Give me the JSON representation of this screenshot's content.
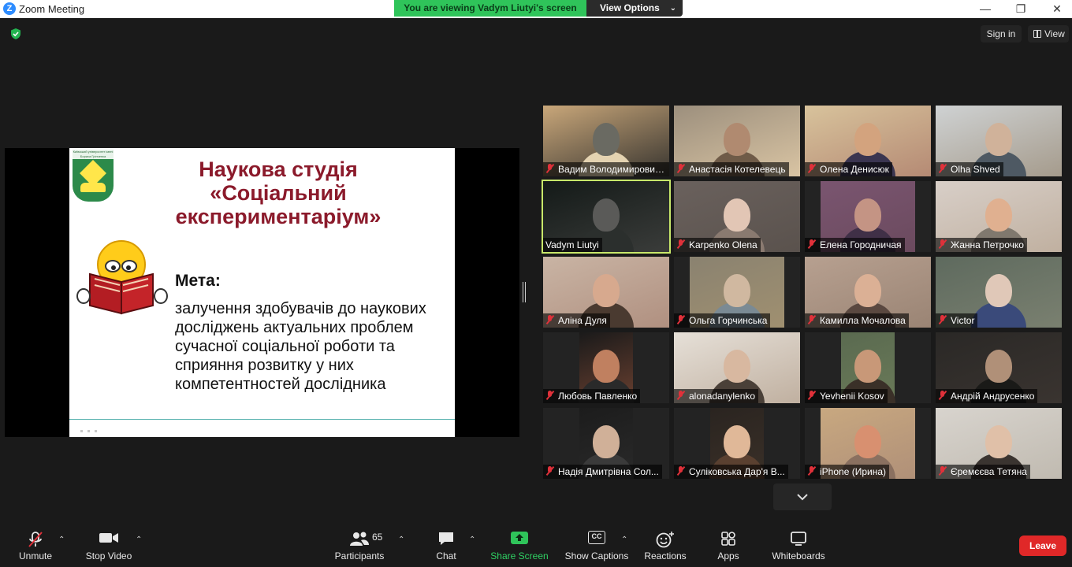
{
  "window": {
    "title": "Zoom Meeting",
    "app_icon_letter": "Z",
    "controls": {
      "minimize": "—",
      "restore": "❐",
      "close": "✕"
    }
  },
  "banner": {
    "viewing_text": "You are viewing Vadym Liutyi's screen",
    "view_options_label": "View Options"
  },
  "top_right": {
    "sign_in_label": "Sign in",
    "view_label": "View"
  },
  "slide": {
    "logo_caption": "Київський університет імені Бориса Грінченка",
    "title_lines": [
      "Наукова студія",
      "«Соціальний",
      "експериментаріум»"
    ],
    "goal_label": "Мета:",
    "goal_text": "залучення здобувачів до наукових досліджень актуальних проблем сучасної соціальної роботи та сприяння розвитку у них компетентностей дослідника"
  },
  "gallery": {
    "participants": [
      {
        "name": "Вадим Володимирович...",
        "muted": true
      },
      {
        "name": "Анастасія Котелевець",
        "muted": true
      },
      {
        "name": "Олена Денисюк",
        "muted": true
      },
      {
        "name": "Olha Shved",
        "muted": true
      },
      {
        "name": "Vadym Liutyi",
        "muted": false,
        "active_speaker": true
      },
      {
        "name": "Karpenko Olena",
        "muted": true
      },
      {
        "name": "Елена Городничая",
        "muted": true
      },
      {
        "name": "Жанна Петрочко",
        "muted": true
      },
      {
        "name": "Аліна Дуля",
        "muted": true
      },
      {
        "name": "Ольга Горчинська",
        "muted": true
      },
      {
        "name": "Камилла Мочалова",
        "muted": true
      },
      {
        "name": "Victor",
        "muted": true
      },
      {
        "name": "Любовь Павленко",
        "muted": true
      },
      {
        "name": "alonadanylenko",
        "muted": true
      },
      {
        "name": "Yevhenii Kosov",
        "muted": true
      },
      {
        "name": "Андрій Андрусенко",
        "muted": true
      },
      {
        "name": "Надія Дмитрівна Сол...",
        "muted": true
      },
      {
        "name": "Суліковська Дар'я В...",
        "muted": true
      },
      {
        "name": "iPhone (Ирина)",
        "muted": true
      },
      {
        "name": "Єремєєва Тетяна",
        "muted": true
      }
    ]
  },
  "toolbar": {
    "unmute_label": "Unmute",
    "stop_video_label": "Stop Video",
    "participants_label": "Participants",
    "participants_count": "65",
    "chat_label": "Chat",
    "share_screen_label": "Share Screen",
    "show_captions_label": "Show Captions",
    "captions_badge": "CC",
    "reactions_label": "Reactions",
    "apps_label": "Apps",
    "whiteboards_label": "Whiteboards",
    "leave_label": "Leave"
  },
  "colors": {
    "accent_green": "#2fc45a",
    "leave_red": "#e02828",
    "active_speaker_outline": "#c8e86a",
    "mute_red": "#e0313a",
    "slide_title": "#8b1a2b"
  }
}
